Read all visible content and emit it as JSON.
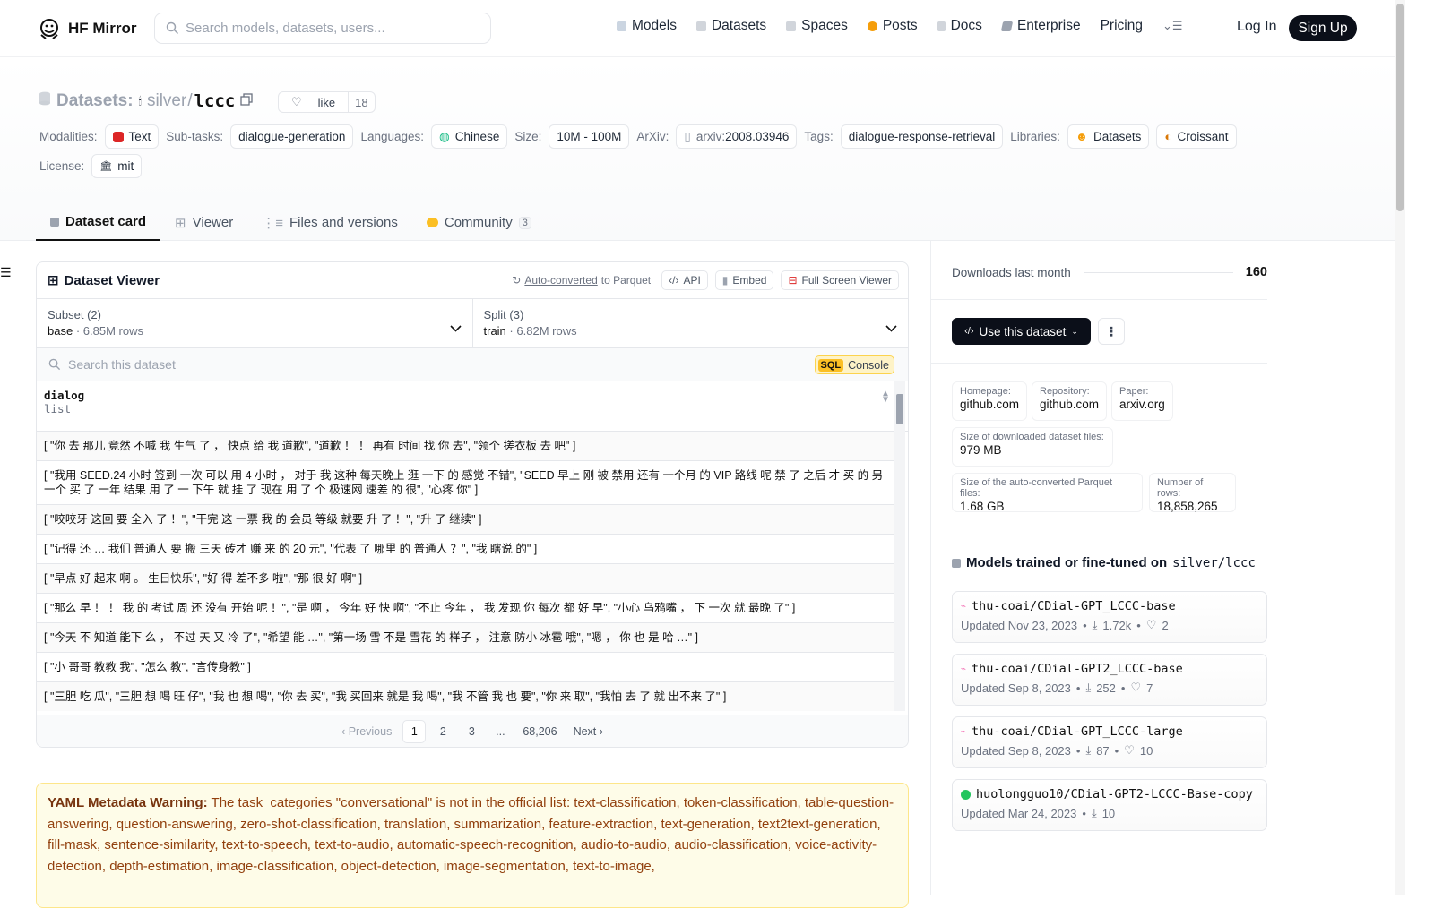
{
  "nav": {
    "brand": "HF Mirror",
    "search_placeholder": "Search models, datasets, users...",
    "links": [
      {
        "label": "Models",
        "color": "#9ca3af"
      },
      {
        "label": "Datasets",
        "color": "#9ca3af"
      },
      {
        "label": "Spaces",
        "color": "#9ca3af"
      },
      {
        "label": "Posts",
        "color": "#f59e0b"
      },
      {
        "label": "Docs",
        "color": "#9ca3af"
      },
      {
        "label": "Enterprise",
        "color": "#6b7280"
      }
    ],
    "pricing": "Pricing",
    "login": "Log In",
    "signup": "Sign Up"
  },
  "header": {
    "section": "Datasets:",
    "owner": "silver",
    "sep": "/",
    "repo": "lccc",
    "like_label": "like",
    "like_count": "18",
    "meta": {
      "modalities_label": "Modalities:",
      "modalities": "Text",
      "subtasks_label": "Sub-tasks:",
      "subtasks": "dialogue-generation",
      "languages_label": "Languages:",
      "languages": "Chinese",
      "size_label": "Size:",
      "size": "10M - 100M",
      "arxiv_label": "ArXiv:",
      "arxiv_prefix": "arxiv:",
      "arxiv_id": "2008.03946",
      "tags_label": "Tags:",
      "tags": "dialogue-response-retrieval",
      "libraries_label": "Libraries:",
      "lib1": "Datasets",
      "lib2": "Croissant",
      "license_label": "License:",
      "license": "mit"
    },
    "tabs": [
      {
        "label": "Dataset card"
      },
      {
        "label": "Viewer"
      },
      {
        "label": "Files and versions"
      },
      {
        "label": "Community",
        "badge": "3"
      }
    ]
  },
  "viewer": {
    "title": "Dataset Viewer",
    "auto_converted": "Auto-converted",
    "to_parquet": "to Parquet",
    "api": "API",
    "embed": "Embed",
    "fullscreen": "Full Screen Viewer",
    "subset_label": "Subset (2)",
    "subset_value": "base",
    "subset_rows": "6.85M rows",
    "split_label": "Split (3)",
    "split_value": "train",
    "split_rows": "6.82M rows",
    "search_placeholder": "Search this dataset",
    "sql": "SQL",
    "console": "Console",
    "column_name": "dialog",
    "column_type": "list",
    "rows": [
      "[ \"你 去 那儿 竟然 不喊 我 生气 了 ， 快点 给 我 道歉\", \"道歉 ！ ！ 再有 时间 找 你 去\", \"领个 搓衣板 去 吧\" ]",
      "[ \"我用 SEED.24 小时 签到 一次 可以 用 4 小时 ， 对于 我 这种 每天晚上 逛 一下 的 感觉 不错\", \"SEED 早上 刚 被 禁用 还有 一个月 的 VIP 路线 呢 禁 了 之后 才 买 的 另 一个 买 了 一年 结果 用 了 一 下午 就 挂 了 现在 用 了 个 极速网 速差 的 很\", \"心疼 你\" ]",
      "[ \"咬咬牙 这回 要 全入 了 ！\", \"干完 这 一票 我 的 会员 等级 就要 升 了 ！\", \"升 了 继续\" ]",
      "[ \"记得 还 … 我们 普通人 要 搬 三天 砖才 赚 来 的 20 元\", \"代表 了 哪里 的 普通人 ？\", \"我 瞎说 的\" ]",
      "[ \"早点 好 起来 啊 。 生日快乐\", \"好 得 差不多 啦\", \"那 很 好 啊\" ]",
      "[ \"那么 早 ！ ！ 我 的 考试 周 还 没有 开始 呢 ！\", \"是 啊 ， 今年 好 快 啊\", \"不止 今年 ， 我 发现 你 每次 都 好 早\", \"小心 乌鸦嘴 ， 下 一次 就 最晚 了\" ]",
      "[ \"今天 不 知道 能下 么 ， 不过 天 又 冷 了\", \"希望 能 …\", \"第一场 雪 不是 雪花 的 样子 ， 注意 防小 冰雹 哦\", \"嗯 ， 你 也 是 哈 …\" ]",
      "[ \"小 哥哥 教教 我\", \"怎么 教\", \"言传身教\" ]",
      "[ \"三胆 吃 瓜\", \"三胆 想 喝 旺 仔\", \"我 也 想 喝\", \"你 去 买\", \"我 买回来 就是 我 喝\", \"我 不管 我 也 要\", \"你 来 取\", \"我怕 去 了 就 出不来 了\" ]"
    ],
    "pager": {
      "prev": "Previous",
      "pages": [
        "1",
        "2",
        "3",
        "...",
        "68,206"
      ],
      "next": "Next"
    }
  },
  "warning": {
    "title": "YAML Metadata Warning:",
    "text": "The task_categories \"conversational\" is not in the official list: text-classification, token-classification, table-question-answering, question-answering, zero-shot-classification, translation, summarization, feature-extraction, text-generation, text2text-generation, fill-mask, sentence-similarity, text-to-speech, text-to-audio, automatic-speech-recognition, audio-to-audio, audio-classification, voice-activity-detection, depth-estimation, image-classification, object-detection, image-segmentation, text-to-image,"
  },
  "sidebar": {
    "downloads_label": "Downloads last month",
    "downloads_value": "160",
    "use_button": "Use this dataset",
    "homepage_label": "Homepage:",
    "homepage": "github.com",
    "repository_label": "Repository:",
    "repository": "github.com",
    "paper_label": "Paper:",
    "paper": "arxiv.org",
    "dl_size_label": "Size of downloaded dataset files:",
    "dl_size": "979 MB",
    "parquet_size_label": "Size of the auto-converted Parquet files:",
    "parquet_size": "1.68 GB",
    "rows_label": "Number of rows:",
    "rows": "18,858,265",
    "models_title": "Models trained or fine-tuned on",
    "models_repo": "silver/lccc",
    "models": [
      {
        "name": "thu-coai/CDial-GPT_LCCC-base",
        "updated": "Updated Nov 23, 2023",
        "downloads": "1.72k",
        "likes": "2"
      },
      {
        "name": "thu-coai/CDial-GPT2_LCCC-base",
        "updated": "Updated Sep 8, 2023",
        "downloads": "252",
        "likes": "7"
      },
      {
        "name": "thu-coai/CDial-GPT_LCCC-large",
        "updated": "Updated Sep 8, 2023",
        "downloads": "87",
        "likes": "10"
      },
      {
        "name": "huolongguo10/CDial-GPT2-LCCC-Base-copy",
        "updated": "Updated Mar 24, 2023",
        "downloads": "10"
      }
    ]
  }
}
